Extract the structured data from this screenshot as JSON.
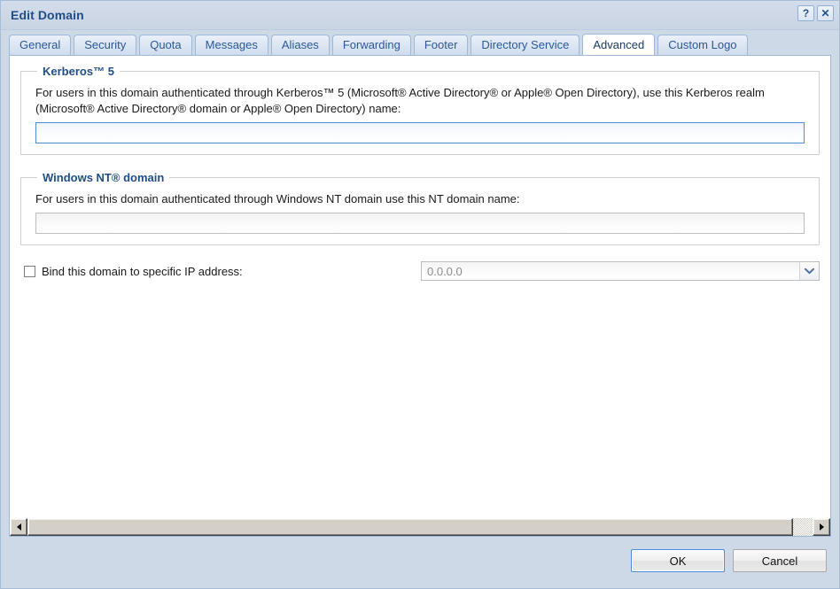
{
  "window": {
    "title": "Edit Domain",
    "help_button": "?",
    "close_button": "✕"
  },
  "tabs": [
    {
      "label": "General",
      "active": false
    },
    {
      "label": "Security",
      "active": false
    },
    {
      "label": "Quota",
      "active": false
    },
    {
      "label": "Messages",
      "active": false
    },
    {
      "label": "Aliases",
      "active": false
    },
    {
      "label": "Forwarding",
      "active": false
    },
    {
      "label": "Footer",
      "active": false
    },
    {
      "label": "Directory Service",
      "active": false
    },
    {
      "label": "Advanced",
      "active": true
    },
    {
      "label": "Custom Logo",
      "active": false
    }
  ],
  "kerberos": {
    "legend": "Kerberos™ 5",
    "description": "For users in this domain authenticated through Kerberos™ 5 (Microsoft® Active Directory® or Apple® Open Directory), use this Kerberos realm (Microsoft® Active Directory® domain or Apple® Open Directory) name:",
    "realm_value": "",
    "realm_placeholder": ""
  },
  "windows_nt": {
    "legend": "Windows NT® domain",
    "description": "For users in this domain authenticated through Windows NT domain use this NT domain name:",
    "domain_value": "",
    "domain_placeholder": ""
  },
  "bind_ip": {
    "checkbox_label": "Bind this domain to specific IP address:",
    "checked": false,
    "selected_value": "0.0.0.0"
  },
  "footer": {
    "ok_label": "OK",
    "cancel_label": "Cancel"
  },
  "colors": {
    "title_text": "#1f4e88",
    "accent": "#4a8ddc",
    "chrome": "#ced9e8",
    "tab_text": "#2a5896"
  }
}
